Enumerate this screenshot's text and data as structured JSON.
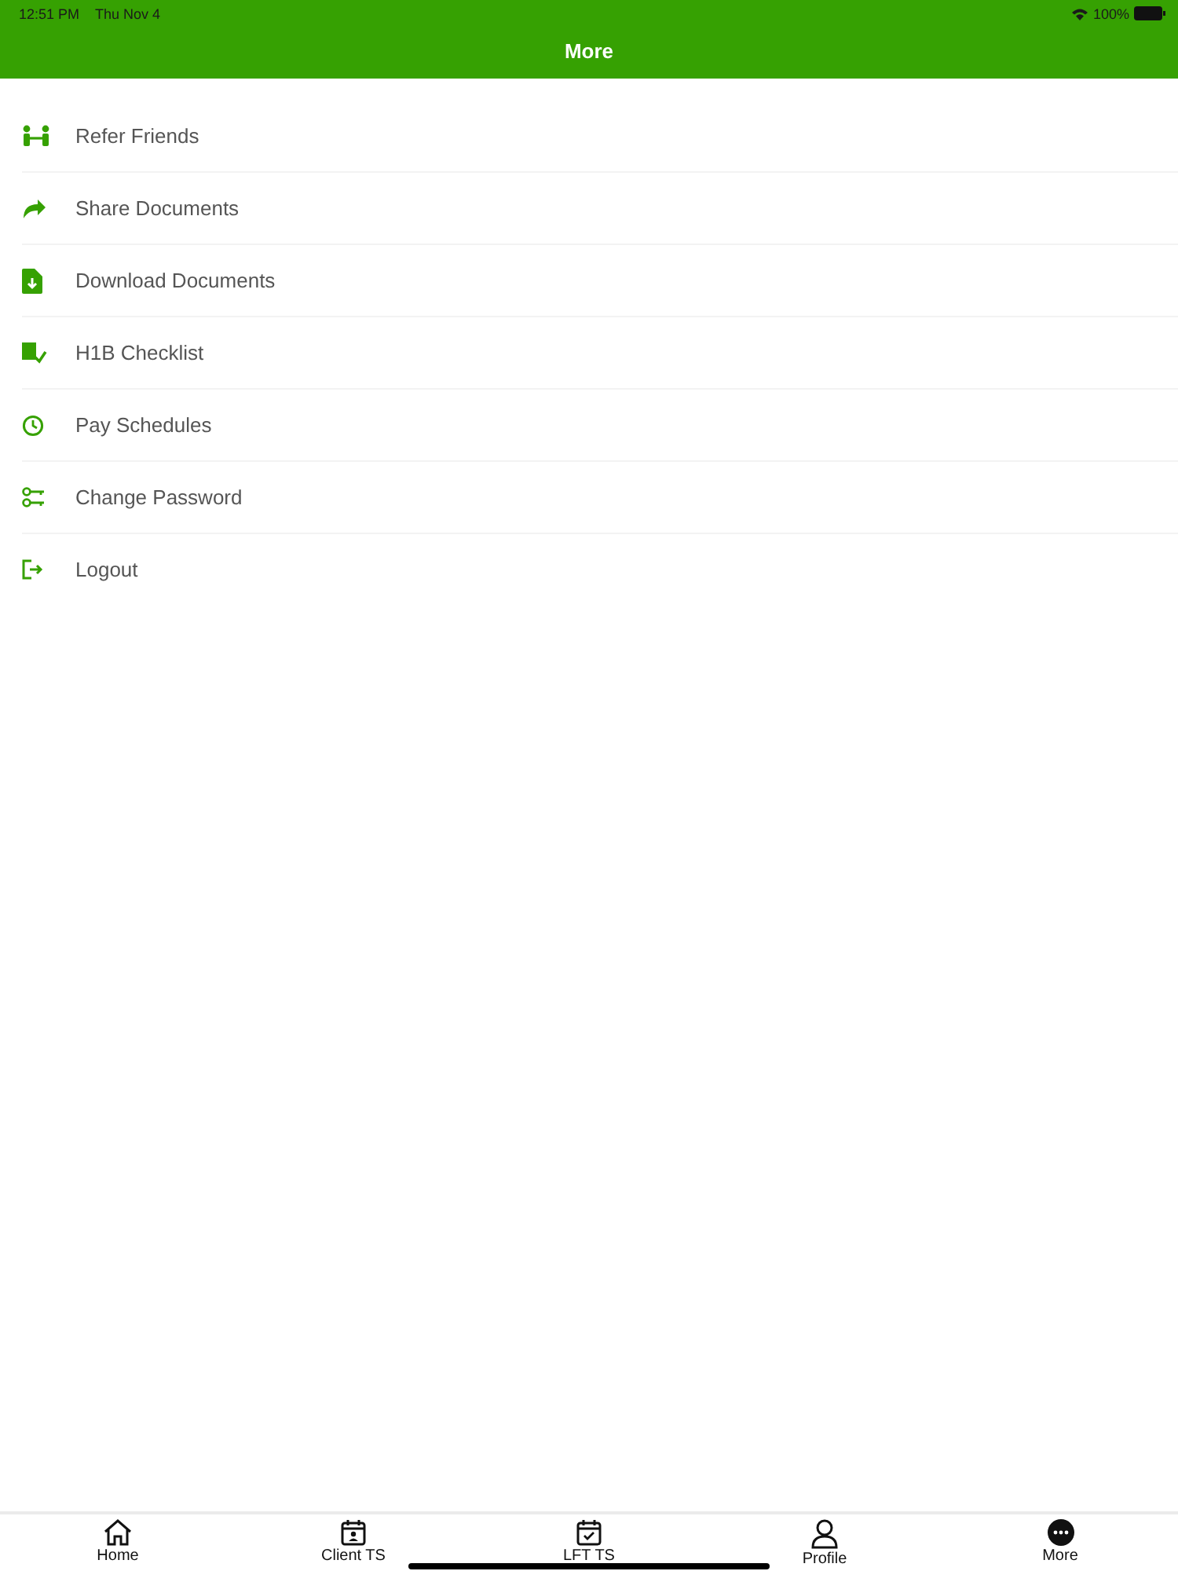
{
  "status_bar": {
    "time": "12:51 PM",
    "date": "Thu Nov 4",
    "battery": "100%"
  },
  "header": {
    "title": "More"
  },
  "menu": [
    {
      "label": "Refer Friends"
    },
    {
      "label": "Share Documents"
    },
    {
      "label": "Download Documents"
    },
    {
      "label": "H1B Checklist"
    },
    {
      "label": "Pay Schedules"
    },
    {
      "label": "Change Password"
    },
    {
      "label": "Logout"
    }
  ],
  "tab_bar": [
    {
      "label": "Home"
    },
    {
      "label": "Client TS"
    },
    {
      "label": "LFT TS"
    },
    {
      "label": "Profile"
    },
    {
      "label": "More"
    }
  ]
}
